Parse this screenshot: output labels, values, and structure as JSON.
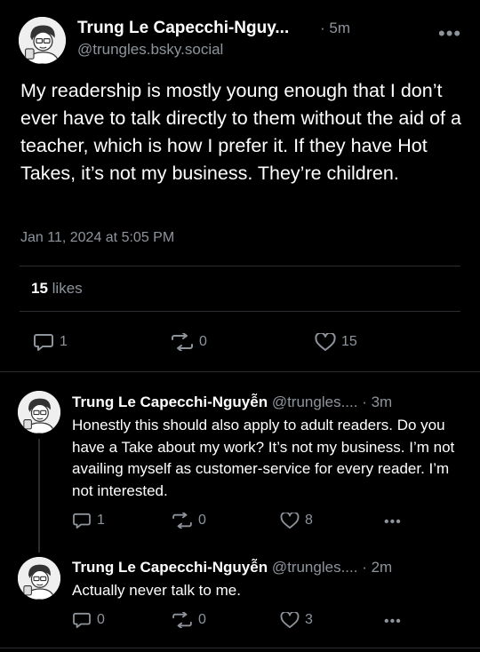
{
  "main_post": {
    "display_name": "Trung Le Capecchi-Nguy...",
    "time": "· 5m",
    "handle": "@trungles.bsky.social",
    "text": "My readership is mostly young enough that I don’t ever have to talk directly to them without the aid of a teacher, which is how I prefer it. If they have Hot Takes, it’s not my business. They’re children.",
    "timestamp": "Jan 11, 2024 at 5:05 PM",
    "likes_count": "15",
    "likes_label": "likes",
    "actions": {
      "replies": "1",
      "reposts": "0",
      "likes": "15"
    }
  },
  "replies": [
    {
      "display_name": "Trung Le Capecchi-Nguyễn",
      "handle": "@trungles....",
      "time": "· 3m",
      "text": "Honestly this should also apply to adult readers. Do you have a Take about my work? It’s not my business. I’m not availing myself as customer-service for every reader. I’m not interested.",
      "actions": {
        "replies": "1",
        "reposts": "0",
        "likes": "8"
      }
    },
    {
      "display_name": "Trung Le Capecchi-Nguyễn",
      "handle": "@trungles....",
      "time": "· 2m",
      "text": "Actually never talk to me.",
      "actions": {
        "replies": "0",
        "reposts": "0",
        "likes": "3"
      }
    }
  ],
  "more_glyph": "•••",
  "colors": {
    "background": "#000000",
    "text": "#ffffff",
    "muted": "#8e949c",
    "divider": "#2a2d31"
  },
  "icons": [
    "avatar-illustration",
    "more-options-icon",
    "reply-icon",
    "repost-icon",
    "like-icon"
  ]
}
